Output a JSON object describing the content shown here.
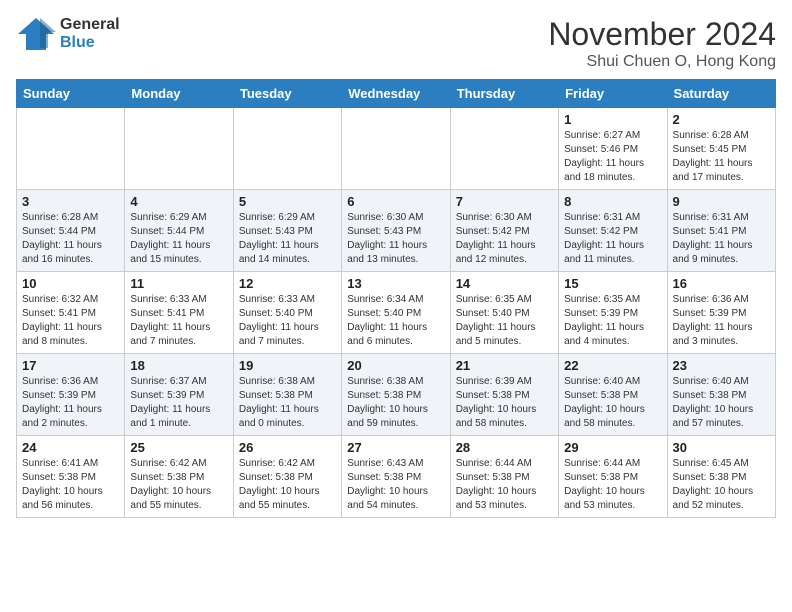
{
  "header": {
    "logo_line1": "General",
    "logo_line2": "Blue",
    "month_title": "November 2024",
    "location": "Shui Chuen O, Hong Kong"
  },
  "weekdays": [
    "Sunday",
    "Monday",
    "Tuesday",
    "Wednesday",
    "Thursday",
    "Friday",
    "Saturday"
  ],
  "weeks": [
    [
      {
        "day": "",
        "info": ""
      },
      {
        "day": "",
        "info": ""
      },
      {
        "day": "",
        "info": ""
      },
      {
        "day": "",
        "info": ""
      },
      {
        "day": "",
        "info": ""
      },
      {
        "day": "1",
        "info": "Sunrise: 6:27 AM\nSunset: 5:46 PM\nDaylight: 11 hours and 18 minutes."
      },
      {
        "day": "2",
        "info": "Sunrise: 6:28 AM\nSunset: 5:45 PM\nDaylight: 11 hours and 17 minutes."
      }
    ],
    [
      {
        "day": "3",
        "info": "Sunrise: 6:28 AM\nSunset: 5:44 PM\nDaylight: 11 hours and 16 minutes."
      },
      {
        "day": "4",
        "info": "Sunrise: 6:29 AM\nSunset: 5:44 PM\nDaylight: 11 hours and 15 minutes."
      },
      {
        "day": "5",
        "info": "Sunrise: 6:29 AM\nSunset: 5:43 PM\nDaylight: 11 hours and 14 minutes."
      },
      {
        "day": "6",
        "info": "Sunrise: 6:30 AM\nSunset: 5:43 PM\nDaylight: 11 hours and 13 minutes."
      },
      {
        "day": "7",
        "info": "Sunrise: 6:30 AM\nSunset: 5:42 PM\nDaylight: 11 hours and 12 minutes."
      },
      {
        "day": "8",
        "info": "Sunrise: 6:31 AM\nSunset: 5:42 PM\nDaylight: 11 hours and 11 minutes."
      },
      {
        "day": "9",
        "info": "Sunrise: 6:31 AM\nSunset: 5:41 PM\nDaylight: 11 hours and 9 minutes."
      }
    ],
    [
      {
        "day": "10",
        "info": "Sunrise: 6:32 AM\nSunset: 5:41 PM\nDaylight: 11 hours and 8 minutes."
      },
      {
        "day": "11",
        "info": "Sunrise: 6:33 AM\nSunset: 5:41 PM\nDaylight: 11 hours and 7 minutes."
      },
      {
        "day": "12",
        "info": "Sunrise: 6:33 AM\nSunset: 5:40 PM\nDaylight: 11 hours and 7 minutes."
      },
      {
        "day": "13",
        "info": "Sunrise: 6:34 AM\nSunset: 5:40 PM\nDaylight: 11 hours and 6 minutes."
      },
      {
        "day": "14",
        "info": "Sunrise: 6:35 AM\nSunset: 5:40 PM\nDaylight: 11 hours and 5 minutes."
      },
      {
        "day": "15",
        "info": "Sunrise: 6:35 AM\nSunset: 5:39 PM\nDaylight: 11 hours and 4 minutes."
      },
      {
        "day": "16",
        "info": "Sunrise: 6:36 AM\nSunset: 5:39 PM\nDaylight: 11 hours and 3 minutes."
      }
    ],
    [
      {
        "day": "17",
        "info": "Sunrise: 6:36 AM\nSunset: 5:39 PM\nDaylight: 11 hours and 2 minutes."
      },
      {
        "day": "18",
        "info": "Sunrise: 6:37 AM\nSunset: 5:39 PM\nDaylight: 11 hours and 1 minute."
      },
      {
        "day": "19",
        "info": "Sunrise: 6:38 AM\nSunset: 5:38 PM\nDaylight: 11 hours and 0 minutes."
      },
      {
        "day": "20",
        "info": "Sunrise: 6:38 AM\nSunset: 5:38 PM\nDaylight: 10 hours and 59 minutes."
      },
      {
        "day": "21",
        "info": "Sunrise: 6:39 AM\nSunset: 5:38 PM\nDaylight: 10 hours and 58 minutes."
      },
      {
        "day": "22",
        "info": "Sunrise: 6:40 AM\nSunset: 5:38 PM\nDaylight: 10 hours and 58 minutes."
      },
      {
        "day": "23",
        "info": "Sunrise: 6:40 AM\nSunset: 5:38 PM\nDaylight: 10 hours and 57 minutes."
      }
    ],
    [
      {
        "day": "24",
        "info": "Sunrise: 6:41 AM\nSunset: 5:38 PM\nDaylight: 10 hours and 56 minutes."
      },
      {
        "day": "25",
        "info": "Sunrise: 6:42 AM\nSunset: 5:38 PM\nDaylight: 10 hours and 55 minutes."
      },
      {
        "day": "26",
        "info": "Sunrise: 6:42 AM\nSunset: 5:38 PM\nDaylight: 10 hours and 55 minutes."
      },
      {
        "day": "27",
        "info": "Sunrise: 6:43 AM\nSunset: 5:38 PM\nDaylight: 10 hours and 54 minutes."
      },
      {
        "day": "28",
        "info": "Sunrise: 6:44 AM\nSunset: 5:38 PM\nDaylight: 10 hours and 53 minutes."
      },
      {
        "day": "29",
        "info": "Sunrise: 6:44 AM\nSunset: 5:38 PM\nDaylight: 10 hours and 53 minutes."
      },
      {
        "day": "30",
        "info": "Sunrise: 6:45 AM\nSunset: 5:38 PM\nDaylight: 10 hours and 52 minutes."
      }
    ]
  ]
}
